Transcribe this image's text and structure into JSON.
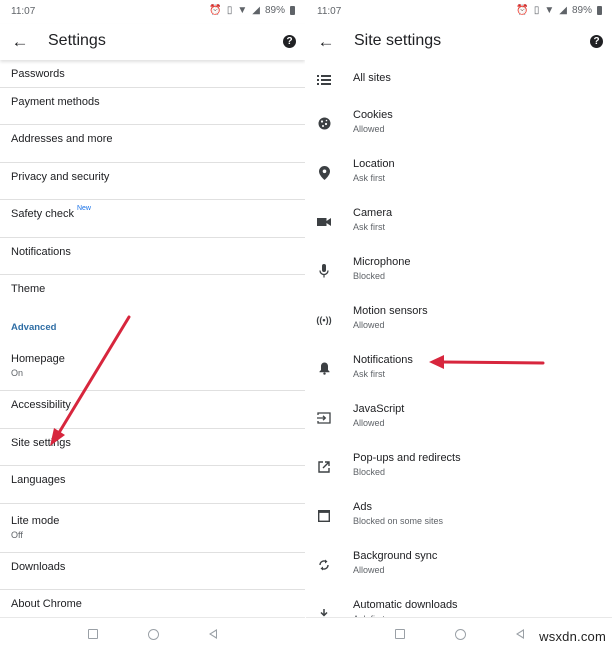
{
  "status_bar": {
    "time": "11:07",
    "battery": "89%",
    "icons": [
      "alarm-icon",
      "vibrate-icon",
      "wifi-icon",
      "signal-icon",
      "battery-icon"
    ]
  },
  "left": {
    "title": "Settings",
    "back_icon": "arrow-left-icon",
    "help_icon": "help-icon",
    "items": [
      {
        "label": "Passwords"
      },
      {
        "label": "Payment methods"
      },
      {
        "label": "Addresses and more"
      },
      {
        "label": "Privacy and security"
      },
      {
        "label": "Safety check",
        "badge": "New"
      },
      {
        "label": "Notifications"
      },
      {
        "label": "Theme"
      }
    ],
    "section_header": "Advanced",
    "advanced_items": [
      {
        "label": "Homepage",
        "sub": "On"
      },
      {
        "label": "Accessibility"
      },
      {
        "label": "Site settings"
      },
      {
        "label": "Languages"
      },
      {
        "label": "Lite mode",
        "sub": "Off"
      },
      {
        "label": "Downloads"
      },
      {
        "label": "About Chrome"
      }
    ]
  },
  "right": {
    "title": "Site settings",
    "back_icon": "arrow-left-icon",
    "help_icon": "help-icon",
    "items": [
      {
        "label": "All sites",
        "icon": "list-icon"
      },
      {
        "label": "Cookies",
        "sub": "Allowed",
        "icon": "cookie-icon"
      },
      {
        "label": "Location",
        "sub": "Ask first",
        "icon": "location-pin-icon"
      },
      {
        "label": "Camera",
        "sub": "Ask first",
        "icon": "camera-icon"
      },
      {
        "label": "Microphone",
        "sub": "Blocked",
        "icon": "microphone-icon"
      },
      {
        "label": "Motion sensors",
        "sub": "Allowed",
        "icon": "motion-sensors-icon"
      },
      {
        "label": "Notifications",
        "sub": "Ask first",
        "icon": "bell-icon"
      },
      {
        "label": "JavaScript",
        "sub": "Allowed",
        "icon": "javascript-icon"
      },
      {
        "label": "Pop-ups and redirects",
        "sub": "Blocked",
        "icon": "popup-icon"
      },
      {
        "label": "Ads",
        "sub": "Blocked on some sites",
        "icon": "ads-icon"
      },
      {
        "label": "Background sync",
        "sub": "Allowed",
        "icon": "sync-icon"
      },
      {
        "label": "Automatic downloads",
        "sub": "Ask first",
        "icon": "download-icon"
      }
    ]
  },
  "nav_bar": {
    "buttons": [
      "recents-button",
      "home-button",
      "back-button"
    ]
  },
  "annotations": {
    "arrow_color": "#d7263d"
  },
  "watermark": "wsxdn.com"
}
